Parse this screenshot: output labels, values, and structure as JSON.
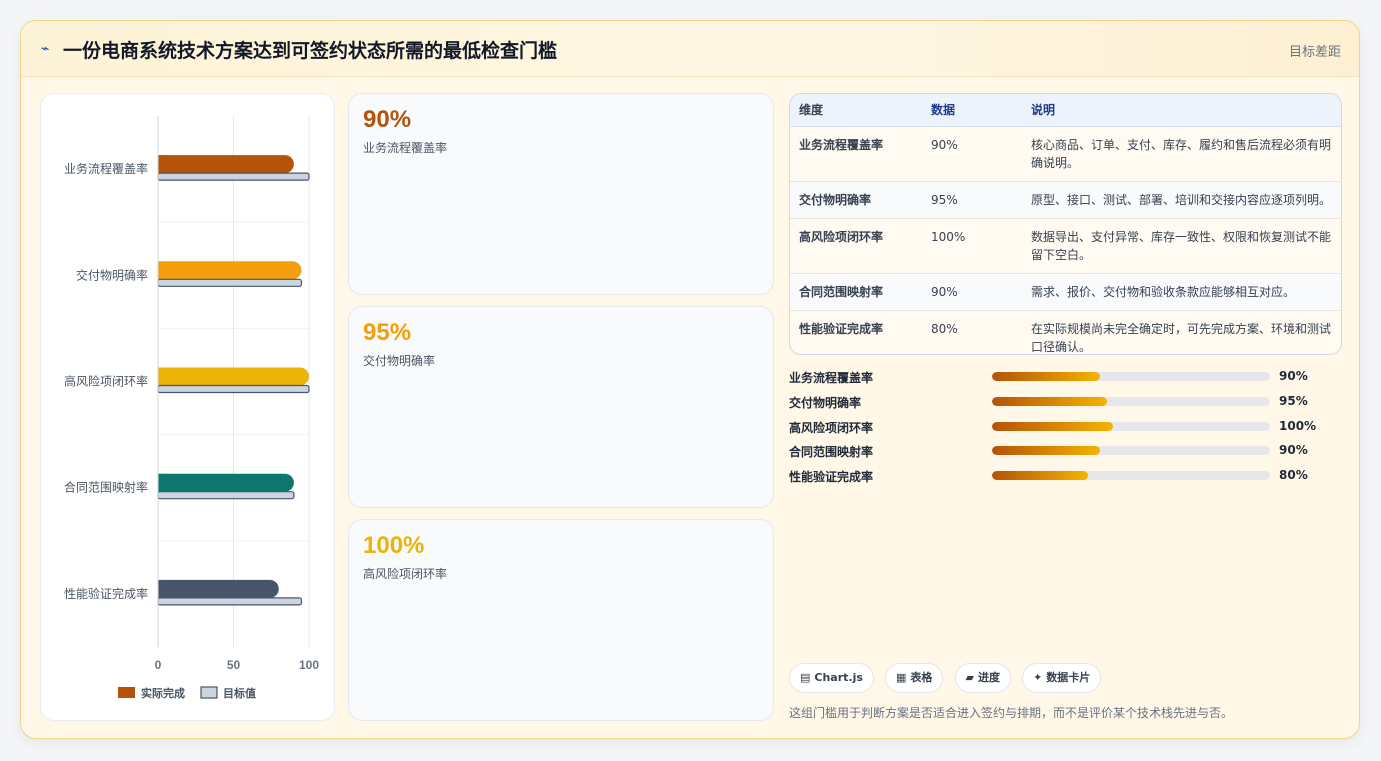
{
  "header": {
    "icon": "lightning-icon",
    "icon_glyph": "⌁",
    "title": "一份电商系统技术方案达到可签约状态所需的最低检查门槛",
    "subtitle": "目标差距"
  },
  "chart_data": {
    "type": "bar",
    "orientation": "horizontal",
    "categories": [
      "业务流程覆盖率",
      "交付物明确率",
      "高风险项闭环率",
      "合同范围映射率",
      "性能验证完成率"
    ],
    "series": [
      {
        "name": "实际完成",
        "values": [
          90,
          95,
          100,
          90,
          80
        ]
      },
      {
        "name": "目标值",
        "values": [
          100,
          95,
          100,
          90,
          95
        ]
      }
    ],
    "bar_colors": [
      "#b45309",
      "#f59e0b",
      "#eab308",
      "#0f766e",
      "#475569"
    ],
    "target_color": "#cbd5e1",
    "xlim": [
      0,
      100
    ],
    "xticks": [
      0,
      50,
      100
    ],
    "legend_position": "bottom",
    "grid": true
  },
  "metrics": [
    {
      "value": "90%",
      "label": "业务流程覆盖率",
      "color": "#b45309"
    },
    {
      "value": "95%",
      "label": "交付物明确率",
      "color": "#f59e0b"
    },
    {
      "value": "100%",
      "label": "高风险项闭环率",
      "color": "#eab308"
    }
  ],
  "table": {
    "headers": [
      "维度",
      "数据",
      "说明"
    ],
    "rows": [
      {
        "dim": "业务流程覆盖率",
        "val": "90%",
        "desc": "核心商品、订单、支付、库存、履约和售后流程必须有明确说明。"
      },
      {
        "dim": "交付物明确率",
        "val": "95%",
        "desc": "原型、接口、测试、部署、培训和交接内容应逐项列明。"
      },
      {
        "dim": "高风险项闭环率",
        "val": "100%",
        "desc": "数据导出、支付异常、库存一致性、权限和恢复测试不能留下空白。"
      },
      {
        "dim": "合同范围映射率",
        "val": "90%",
        "desc": "需求、报价、交付物和验收条款应能够相互对应。"
      },
      {
        "dim": "性能验证完成率",
        "val": "80%",
        "desc": "在实际规模尚未完全确定时，可先完成方案、环境和测试口径确认。"
      }
    ]
  },
  "progress": [
    {
      "label": "业务流程覆盖率",
      "value": "90%",
      "fraction": 0.39
    },
    {
      "label": "交付物明确率",
      "value": "95%",
      "fraction": 0.415
    },
    {
      "label": "高风险项闭环率",
      "value": "100%",
      "fraction": 0.435
    },
    {
      "label": "合同范围映射率",
      "value": "90%",
      "fraction": 0.39
    },
    {
      "label": "性能验证完成率",
      "value": "80%",
      "fraction": 0.345
    }
  ],
  "chips": [
    {
      "icon": "chart-icon",
      "glyph": "▤",
      "label": "Chart.js"
    },
    {
      "icon": "table-icon",
      "glyph": "▦",
      "label": "表格"
    },
    {
      "icon": "progress-icon",
      "glyph": "▰",
      "label": "进度"
    },
    {
      "icon": "sparkle-icon",
      "glyph": "✦",
      "label": "数据卡片"
    }
  ],
  "footnote": "这组门槛用于判断方案是否适合进入签约与排期，而不是评价某个技术栈先进与否。"
}
